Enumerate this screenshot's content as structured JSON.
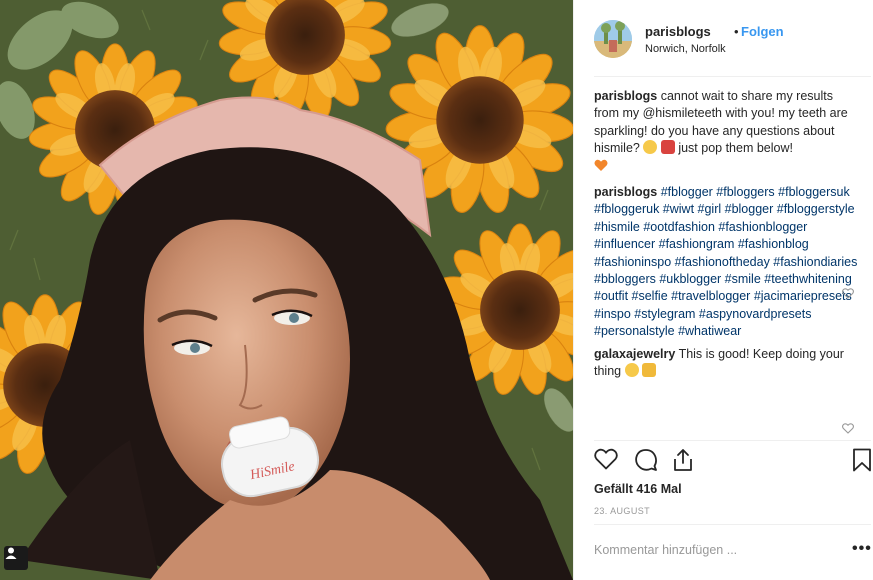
{
  "post": {
    "username": "parisblogs",
    "separator": "•",
    "follow_label": "Folgen",
    "location": "Norwich, Norfolk",
    "photo_text": "HiSmile",
    "caption": {
      "user": "parisblogs",
      "text": "cannot wait to share my results from my @hismileteeth with you! my teeth are sparkling! do you have any questions about hismile?",
      "text_end": "just pop them below!"
    },
    "hashtags_comment": {
      "user": "parisblogs",
      "text": "#fblogger #fbloggers #fbloggersuk #fbloggeruk #wiwt #girl #blogger #fbloggerstyle #hismile #ootdfashion #fashionblogger #influencer #fashiongram #fashionblog #fashioninspo #fashionoftheday #fashiondiaries #bbloggers #ukblogger #smile #teethwhitening #outfit #selfie #travelblogger #jacimariepresets #inspo #stylegram #aspynovardpresets #personalstyle #whatiwear"
    },
    "reply_comment": {
      "user": "galaxajewelry",
      "text": "This is good! Keep doing your thing"
    },
    "likes_label": "Gefällt 416 Mal",
    "date_label": "23. AUGUST",
    "add_comment_placeholder": "Kommentar hinzufügen ...",
    "more_label": "•••"
  },
  "icons": {
    "like": "heart-outline-icon",
    "comment": "comment-bubble-icon",
    "share": "share-icon",
    "save": "bookmark-icon",
    "comment_like": "small-heart-icon",
    "user_badge": "user-tag-icon"
  },
  "colors": {
    "accent": "#3897f0",
    "text": "#262626",
    "muted": "#999999",
    "divider": "#efefef"
  }
}
